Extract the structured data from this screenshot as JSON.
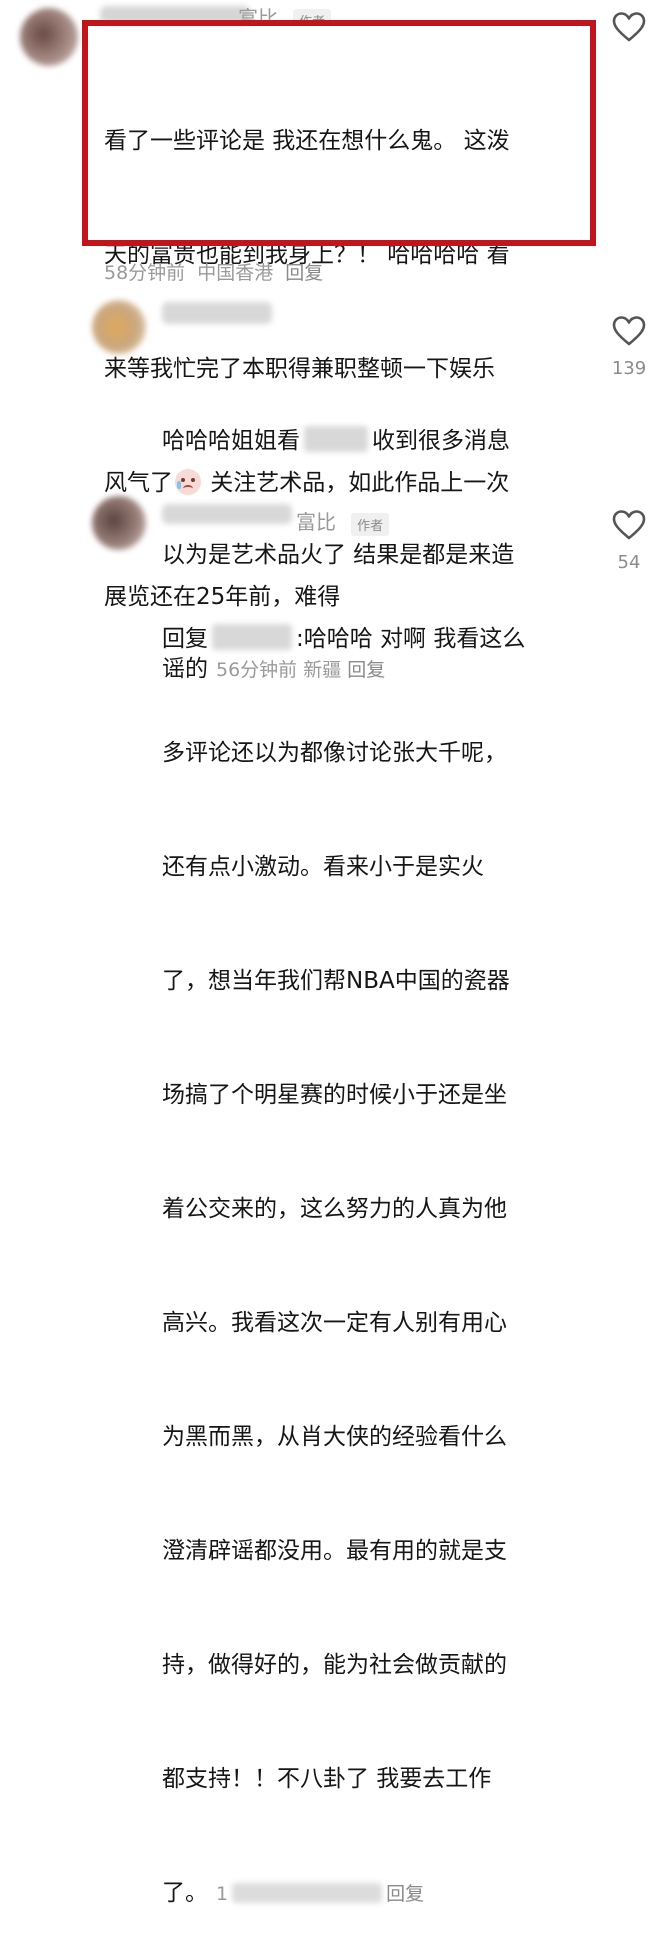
{
  "comments": [
    {
      "name": "富比",
      "author_tag": "作者",
      "text_lines": [
        "看了一些评论是 我还在想什么鬼。 这泼",
        "天的富贵也能到我身上？！ 哈哈哈哈 看",
        "来等我忙完了本职得兼职整顿一下娱乐",
        "风气了",
        " 关注艺术品，如此作品上一次",
        "展览还在25年前，难得"
      ],
      "time": "58分钟前",
      "location": "中国香港",
      "reply_label": "回复"
    },
    {
      "text_lines": [
        "哈哈哈姐姐看",
        "收到很多消息",
        "以为是艺术品火了 结果是都是来造",
        "谣的"
      ],
      "time": "56分钟前",
      "location": "新疆",
      "reply_label": "回复",
      "likes": "139"
    },
    {
      "name": "富比",
      "author_tag": "作者",
      "reply_prefix": "回复",
      "text_lines": [
        ":哈哈哈 对啊 我看这么",
        "多评论还以为都像讨论张大千呢，",
        "还有点小激动。看来小于是实火",
        "了，想当年我们帮NBA中国的瓷器",
        "场搞了个明星赛的时候小于还是坐",
        "着公交来的，这么努力的人真为他",
        "高兴。我看这次一定有人别有用心",
        "为黑而黑，从肖大侠的经验看什么",
        "澄清辟谣都没用。最有用的就是支",
        "持，做得好的，能为社会做贡献的",
        "都支持！！不八卦了 我要去工作",
        "了。"
      ],
      "partial_time": "1",
      "reply_label": "回复",
      "likes": "54"
    }
  ],
  "colors": {
    "highlight": "#c2141b",
    "meta": "#9a9a9a"
  },
  "icons": [
    "heart-outline-icon",
    "crying-emoji-icon"
  ]
}
